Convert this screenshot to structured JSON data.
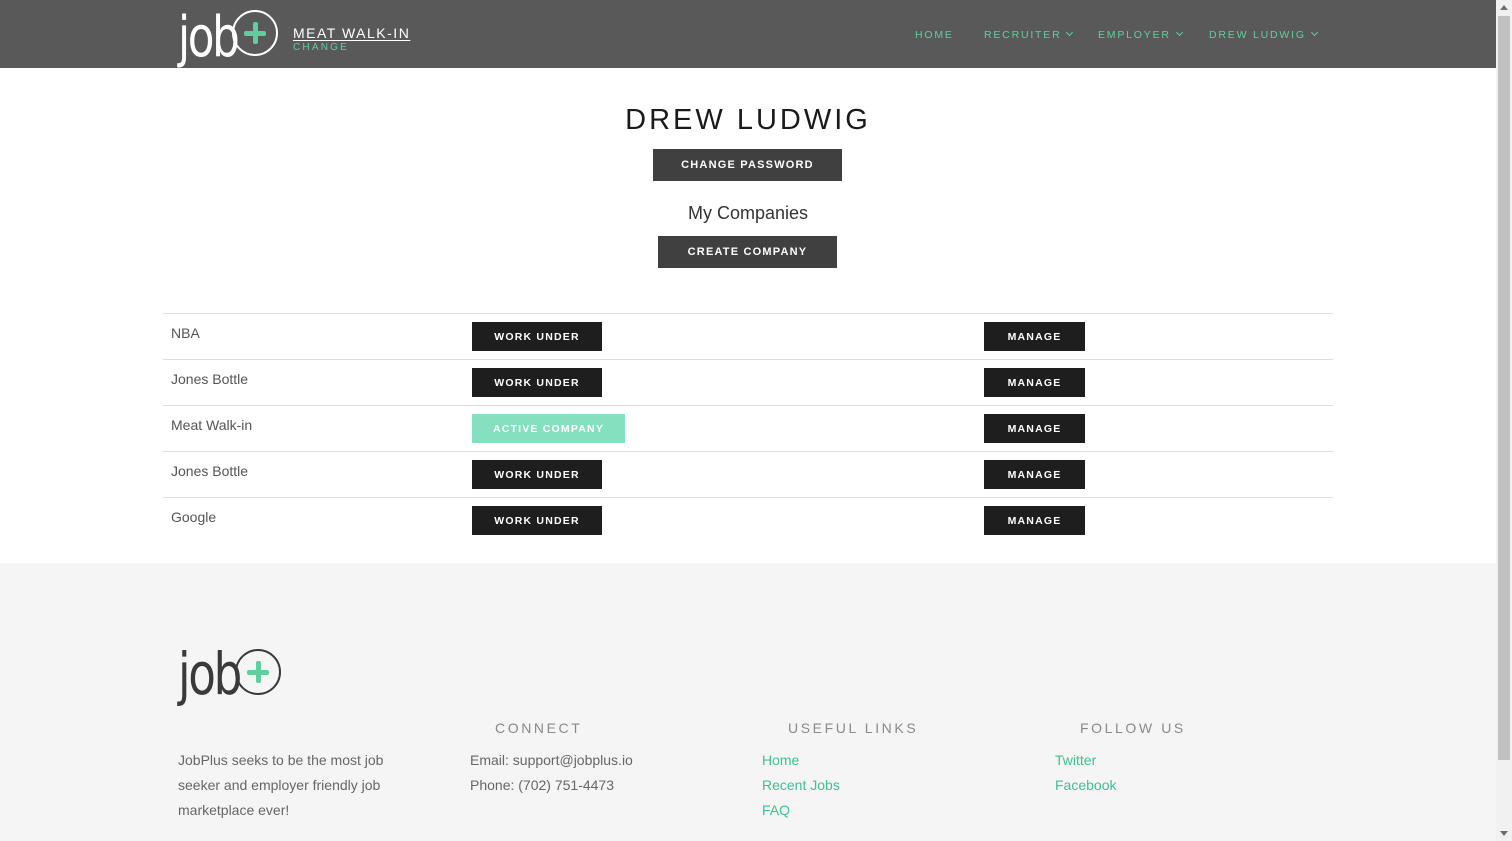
{
  "header": {
    "logo_text": "job",
    "company": {
      "name": "MEAT WALK-IN",
      "change_label": "CHANGE"
    },
    "nav": [
      {
        "label": "HOME",
        "dropdown": false
      },
      {
        "label": "RECRUITER",
        "dropdown": true
      },
      {
        "label": "EMPLOYER",
        "dropdown": true
      },
      {
        "label": "DREW LUDWIG",
        "dropdown": true
      }
    ]
  },
  "profile": {
    "name": "DREW LUDWIG",
    "change_password_label": "CHANGE PASSWORD",
    "companies_heading": "My Companies",
    "create_company_label": "CREATE COMPANY"
  },
  "companies": {
    "work_under_label": "WORK UNDER",
    "active_label": "ACTIVE COMPANY",
    "manage_label": "MANAGE",
    "rows": [
      {
        "name": "NBA",
        "active": false
      },
      {
        "name": "Jones Bottle",
        "active": false
      },
      {
        "name": "Meat Walk-in",
        "active": true
      },
      {
        "name": "Jones Bottle",
        "active": false
      },
      {
        "name": "Google",
        "active": false
      }
    ]
  },
  "footer": {
    "logo_text": "job",
    "about": "JobPlus seeks to be the most job seeker and employer friendly job marketplace ever!",
    "connect": {
      "heading": "CONNECT",
      "email": "Email: support@jobplus.io",
      "phone": "Phone: (702) 751-4473"
    },
    "useful_links": {
      "heading": "USEFUL LINKS",
      "links": [
        "Home",
        "Recent Jobs",
        "FAQ"
      ]
    },
    "follow_us": {
      "heading": "FOLLOW US",
      "links": [
        "Twitter",
        "Facebook"
      ]
    }
  },
  "colors": {
    "header_bg": "#595959",
    "accent": "#5fcf9e",
    "dark_button": "#1e1e1e",
    "active_button": "#84e0bf",
    "footer_bg": "#f5f5f5"
  }
}
